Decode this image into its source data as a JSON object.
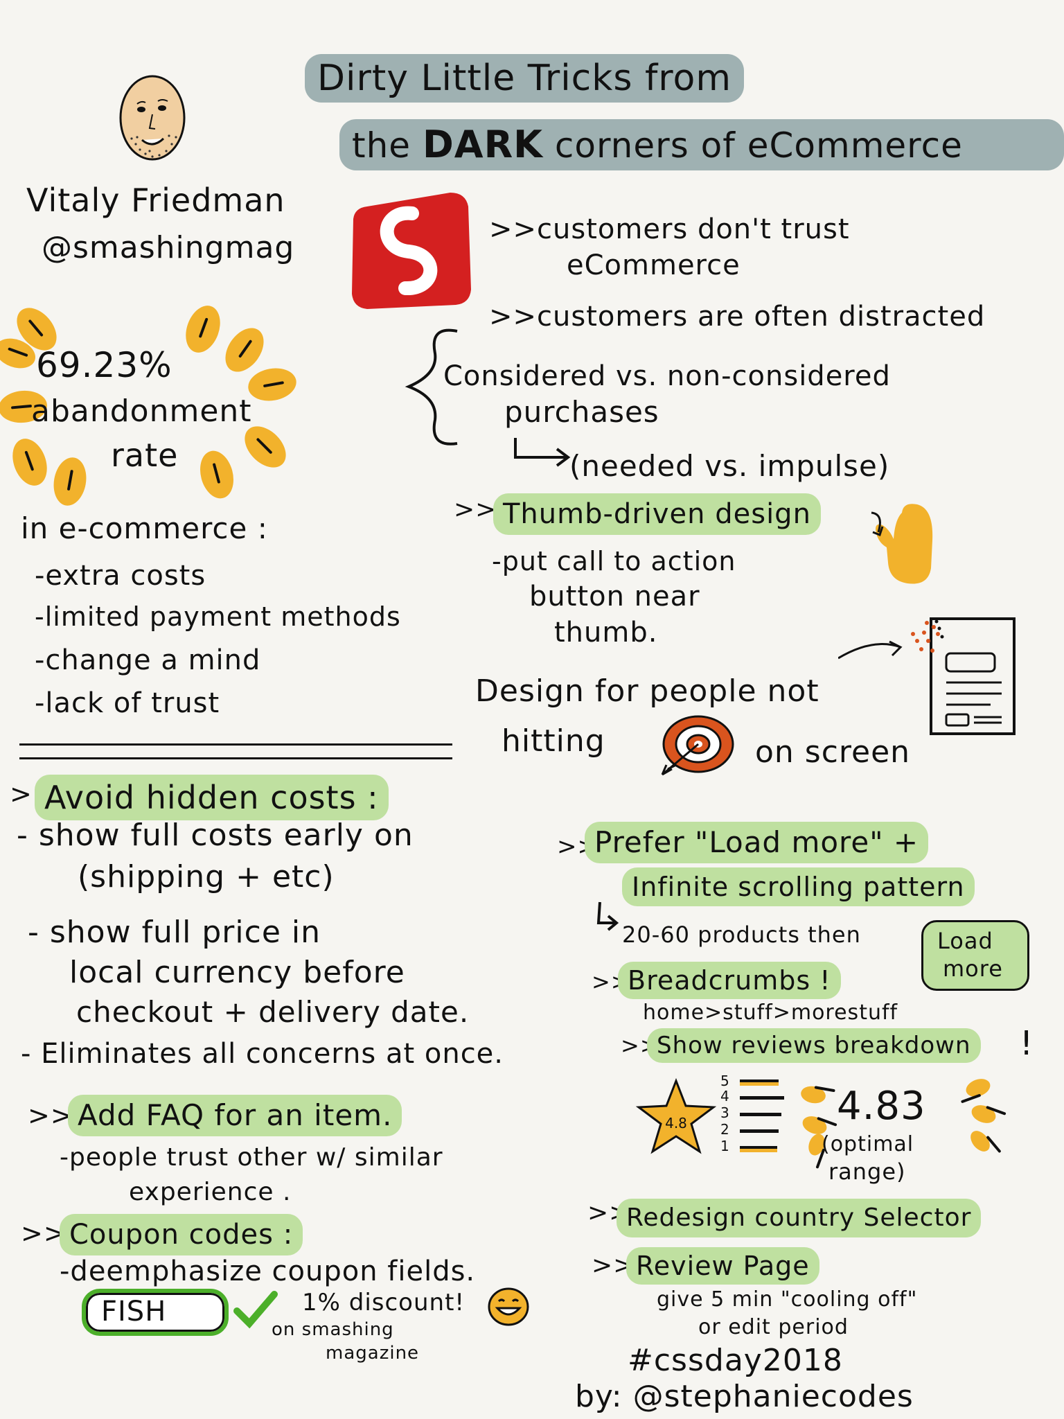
{
  "title": {
    "line1": "Dirty Little Tricks from",
    "line2_pre": "the",
    "line2_dark": "DARK",
    "line2_post": "corners of eCommerce"
  },
  "speaker": {
    "name": "Vitaly Friedman",
    "handle": "@smashingmag"
  },
  "stat": {
    "value": "69.23%",
    "label1": "abandonment",
    "label2": "rate"
  },
  "ecommerce": {
    "heading": "in e-commerce :",
    "items": [
      "-extra costs",
      "-limited payment methods",
      "-change a mind",
      "-lack of trust"
    ]
  },
  "trust": {
    "item1_line1": ">>customers don't trust",
    "item1_line2": "eCommerce",
    "item2": ">>customers are often distracted",
    "considered_line1": "Considered vs. non-considered",
    "considered_line2": "purchases",
    "considered_line3": "(needed vs. impulse)"
  },
  "thumb": {
    "heading": "Thumb-driven design",
    "prefix": ">>",
    "line1": "-put call to action",
    "line2": "button near",
    "line3": "thumb."
  },
  "design": {
    "line1": "Design for people not",
    "line2": "hitting",
    "line3": "on screen"
  },
  "hidden_costs": {
    "prefix": ">>",
    "heading": "Avoid hidden costs :",
    "l1": "- show full costs early on",
    "l2": "(shipping + etc)",
    "l3": "- show full price in",
    "l4": "local currency before",
    "l5": "checkout + delivery date.",
    "l6": "- Eliminates all concerns at once."
  },
  "faq": {
    "prefix": ">>",
    "heading": "Add FAQ for an item.",
    "l1": "-people trust other w/ similar",
    "l2": "experience ."
  },
  "coupon": {
    "prefix": ">>",
    "heading": "Coupon codes :",
    "l1": "-deemphasize coupon fields.",
    "code": "FISH",
    "discount": "1% discount!",
    "note1": "on smashing",
    "note2": "magazine"
  },
  "load_more": {
    "prefix": ">>",
    "heading1": "Prefer \"Load more\" +",
    "heading2": "Infinite scrolling pattern",
    "l1": "20-60 products then",
    "button1": "Load",
    "button2": "more"
  },
  "breadcrumbs": {
    "prefix": ">>",
    "heading": "Breadcrumbs !",
    "l1": "home>stuff>morestuff"
  },
  "reviews": {
    "prefix": ">>",
    "heading": "Show reviews breakdown",
    "bang": "!",
    "star_value": "4.8",
    "rating_levels": [
      "5",
      "4",
      "3",
      "2",
      "1"
    ],
    "score": "4.83",
    "note1": "(optimal",
    "note2": "range)"
  },
  "country": {
    "prefix": ">>",
    "heading": "Redesign country Selector"
  },
  "review_page": {
    "prefix": ">>",
    "heading": "Review Page",
    "l1": "give 5 min \"cooling off\"",
    "l2": "or edit period"
  },
  "footer": {
    "hashtag": "#cssday2018",
    "credit": "by: @stephaniecodes"
  },
  "colors": {
    "green_highlight": "#bfe0a0",
    "grey_highlight": "#9fb1b2",
    "yellow": "#f2b22c",
    "red": "#d42020",
    "orange": "#d9541e"
  },
  "icons": [
    "avatar-face",
    "smashing-logo",
    "bracket",
    "arrow",
    "thumb-mitten",
    "phone-wireframe",
    "target",
    "star",
    "smiley",
    "checkmark"
  ]
}
